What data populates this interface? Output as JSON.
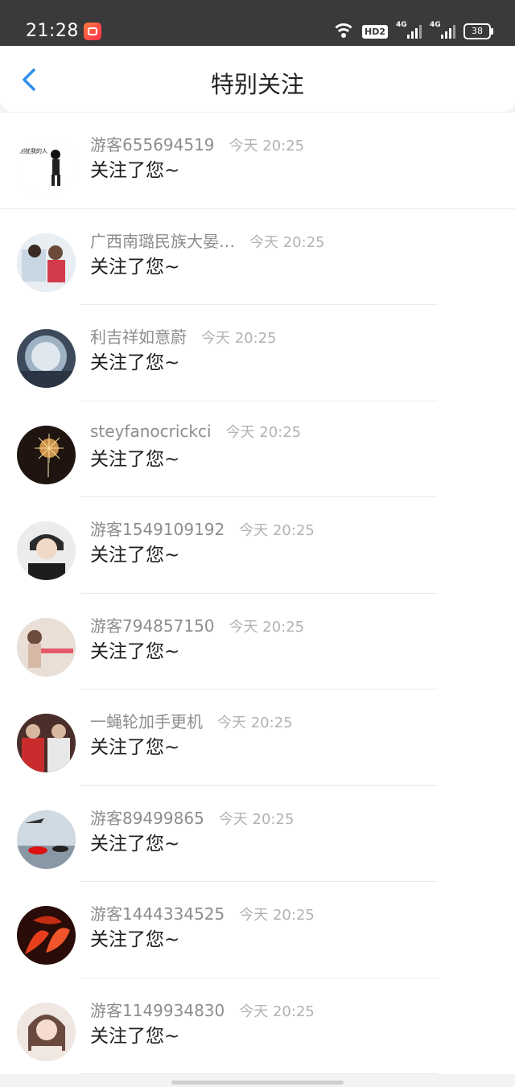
{
  "status_bar": {
    "time": "21:28",
    "network_badge": "HD2",
    "signal1_label": "4G",
    "signal2_label": "4G",
    "battery": "38",
    "icons": [
      "app-icon",
      "wifi-icon",
      "hd-icon",
      "signal-icon",
      "signal-icon",
      "battery-icon"
    ]
  },
  "header": {
    "title": "特别关注",
    "back_icon": "chevron-left-icon",
    "accent": "#2f8ff0"
  },
  "items": [
    {
      "name": "游客655694519",
      "time": "今天 20:25",
      "message": "关注了您~"
    },
    {
      "name": "广西南璐民族大晏…",
      "time": "今天 20:25",
      "message": "关注了您~"
    },
    {
      "name": "利吉祥如意蔚",
      "time": "今天 20:25",
      "message": "关注了您~"
    },
    {
      "name": "steyfanocrickci",
      "time": "今天 20:25",
      "message": "关注了您~"
    },
    {
      "name": "游客1549109192",
      "time": "今天 20:25",
      "message": "关注了您~"
    },
    {
      "name": "游客794857150",
      "time": "今天 20:25",
      "message": "关注了您~"
    },
    {
      "name": "一蝇轮加手更机",
      "time": "今天 20:25",
      "message": "关注了您~"
    },
    {
      "name": "游客89499865",
      "time": "今天 20:25",
      "message": "关注了您~"
    },
    {
      "name": "游客1444334525",
      "time": "今天 20:25",
      "message": "关注了您~"
    },
    {
      "name": "游客1149934830",
      "time": "今天 20:25",
      "message": "关注了您~"
    }
  ]
}
